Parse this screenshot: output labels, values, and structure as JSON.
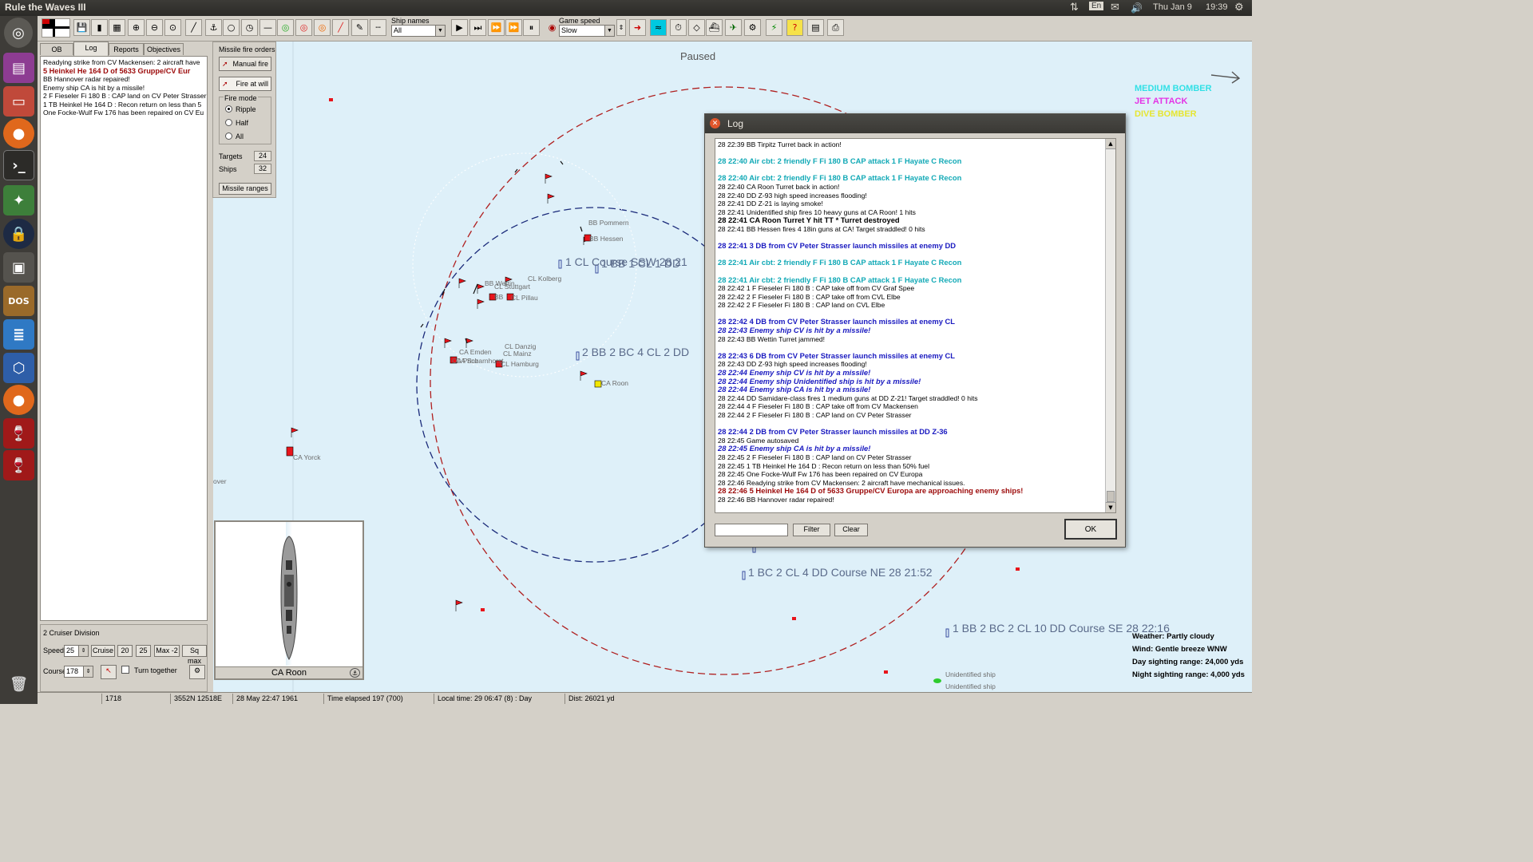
{
  "topbar": {
    "app_title": "Rule the Waves III",
    "lang": "En",
    "date": "Thu Jan 9",
    "time": "19:39"
  },
  "launcher": {
    "items": [
      "ubuntu-dash",
      "system-monitor",
      "file-manager",
      "firefox",
      "terminal",
      "color-app",
      "lock-app",
      "window-app",
      "dosbox",
      "text-editor",
      "virtualbox",
      "firefox-alt",
      "wine-app-1",
      "wine-app-2",
      "trash"
    ]
  },
  "toolbar": {
    "ship_names_label": "Ship names",
    "ship_names_value": "All",
    "game_speed_label": "Game speed",
    "game_speed_value": "Slow"
  },
  "left_panel": {
    "tabs": [
      "OB",
      "Log",
      "Reports",
      "Objectives"
    ],
    "active_tab": "Log",
    "log_lines": [
      {
        "text": "Readying strike from CV Mackensen: 2 aircraft have",
        "style": "normal"
      },
      {
        "text": "5 Heinkel He 164 D of 5633 Gruppe/CV Eur",
        "style": "red"
      },
      {
        "text": "BB Hannover radar repaired!",
        "style": "normal"
      },
      {
        "text": "Enemy ship CA is hit by a missile!",
        "style": "normal"
      },
      {
        "text": "2 F Fieseler Fi 180 B : CAP land on CV Peter Strasser",
        "style": "normal"
      },
      {
        "text": "1 TB Heinkel He 164 D : Recon return on less than 5",
        "style": "normal"
      },
      {
        "text": "One Focke-Wulf Fw 176 has been repaired on CV Eu",
        "style": "normal"
      }
    ],
    "division_title": "2 Cruiser Division",
    "speed_label": "Speed",
    "speed_value": "25",
    "speed_buttons": [
      "Cruise",
      "20",
      "25",
      "Max -2",
      "Sq max"
    ],
    "course_label": "Course",
    "course_value": "178",
    "turn_together_label": "Turn together"
  },
  "missile_panel": {
    "title": "Missile fire orders",
    "manual_fire": "Manual fire",
    "fire_at_will": "Fire at will",
    "fire_mode_label": "Fire mode",
    "modes": [
      "Ripple",
      "Half",
      "All"
    ],
    "selected_mode": "Ripple",
    "targets_label": "Targets",
    "targets_value": "24",
    "ships_label": "Ships",
    "ships_value": "32",
    "missile_ranges": "Missile ranges"
  },
  "map": {
    "paused_label": "Paused",
    "legend": [
      {
        "text": "MEDIUM BOMBER",
        "color": "#33e0e6"
      },
      {
        "text": "JET ATTACK",
        "color": "#e433e6"
      },
      {
        "text": "DIVE BOMBER",
        "color": "#e6e633"
      }
    ],
    "ship_labels": [
      "BB Pommern",
      "BB Hessen",
      "CL Kolberg",
      "BB Wettin",
      "CL Stuttgart",
      "BB",
      "CL Pillau",
      "CA Emden",
      "CA Prinz",
      "CA Scharnhorst",
      "CL Danzig",
      "CL Mainz",
      "CL Hamburg",
      "CA Roon",
      "CA Yorck",
      "Unidentified ship",
      "Unidentified ship"
    ],
    "group_labels": [
      "1 CL Course SSW 28 21",
      "1 BB 1 CL 1 DD",
      "2 BB 2 BC 4 CL 2 DD",
      "1 BC 2 CL 4 DD Course NE 28 21:52",
      "1 BB 2 BC 2 CL 10 DD Course SE 28 22:16"
    ],
    "partial_text": "over",
    "weather_lines": [
      "Weather: Partly cloudy",
      "Wind: Gentle breeze  WNW",
      "Day sighting range: 24,000 yds",
      "Night sighting range: 4,000 yds"
    ],
    "selected_ship_name": "CA Roon",
    "colors": {
      "sea": "#def0f9",
      "friendly_flag": "#e8141b",
      "selected_ship": "#f2e600",
      "red_circle": "#b02020",
      "blue_circle": "#1a2a7a"
    }
  },
  "statusbar": {
    "fields": [
      "1718",
      "3552N 12518E",
      "28 May 22:47 1961",
      "Time elapsed 197 (700)",
      "Local time: 29 06:47 (8) : Day",
      "Dist: 26021 yd"
    ]
  },
  "log_dialog": {
    "title": "Log",
    "filter_button": "Filter",
    "clear_button": "Clear",
    "ok_button": "OK",
    "entries": [
      {
        "t": "28 22:39  BB Tirpitz Turret back in action!",
        "s": "normal"
      },
      {
        "t": "",
        "s": "blank"
      },
      {
        "t": "28 22:40  Air cbt: 2  friendly F Fi 180 B CAP attack 1 F Hayate C Recon",
        "s": "teal"
      },
      {
        "t": "",
        "s": "blank"
      },
      {
        "t": "28 22:40  Air cbt: 2  friendly F Fi 180 B CAP attack 1 F Hayate C Recon",
        "s": "teal"
      },
      {
        "t": "28 22:40  CA Roon Turret back in action!",
        "s": "normal"
      },
      {
        "t": "28 22:40  DD Z-93 high speed increases flooding!",
        "s": "normal"
      },
      {
        "t": "28 22:41  DD Z-21 is laying smoke!",
        "s": "normal"
      },
      {
        "t": "28 22:41  Unidentified ship fires 10 heavy guns at CA Roon! 1 hits",
        "s": "normal"
      },
      {
        "t": "28 22:41   CA Roon Turret Y hit TT * Turret destroyed",
        "s": "bold"
      },
      {
        "t": "28 22:41  BB Hessen fires 4 18in guns at CA! Target straddled!  0 hits",
        "s": "normal"
      },
      {
        "t": "",
        "s": "blank"
      },
      {
        "t": "28 22:41   3 DB from CV Peter Strasser launch missiles at enemy DD",
        "s": "blue"
      },
      {
        "t": "",
        "s": "blank"
      },
      {
        "t": "28 22:41  Air cbt: 2  friendly F Fi 180 B CAP attack 1 F Hayate C Recon",
        "s": "teal"
      },
      {
        "t": "",
        "s": "blank"
      },
      {
        "t": "28 22:41  Air cbt: 2  friendly F Fi 180 B CAP attack 1 F Hayate C Recon",
        "s": "teal"
      },
      {
        "t": "28 22:42  1 F Fieseler Fi 180 B : CAP take off from CV Graf Spee",
        "s": "normal"
      },
      {
        "t": "28 22:42  2 F Fieseler Fi 180 B : CAP take off from CVL Elbe",
        "s": "normal"
      },
      {
        "t": "28 22:42  2 F Fieseler Fi 180 B : CAP land on CVL Elbe",
        "s": "normal"
      },
      {
        "t": "",
        "s": "blank"
      },
      {
        "t": "28 22:42   4 DB from CV Peter Strasser launch missiles at enemy CL",
        "s": "blue"
      },
      {
        "t": "28 22:43    Enemy ship CV is hit by a missile!",
        "s": "dblue"
      },
      {
        "t": "28 22:43  BB Wettin Turret jammed!",
        "s": "normal"
      },
      {
        "t": "",
        "s": "blank"
      },
      {
        "t": "28 22:43   6 DB from CV Peter Strasser launch missiles at enemy CL",
        "s": "blue"
      },
      {
        "t": "28 22:43  DD Z-93 high speed increases flooding!",
        "s": "normal"
      },
      {
        "t": "28 22:44    Enemy ship CV is hit by a missile!",
        "s": "dblue"
      },
      {
        "t": "28 22:44    Enemy ship Unidentified ship is hit by a missile!",
        "s": "dblue"
      },
      {
        "t": "28 22:44   Enemy ship CA is hit by a missile!",
        "s": "dblue"
      },
      {
        "t": "28 22:44  DD Samidare-class fires 1 medium guns at DD Z-21! Target straddled!  0 hits",
        "s": "normal"
      },
      {
        "t": "28 22:44  4 F Fieseler Fi 180 B : CAP take off from CV Mackensen",
        "s": "normal"
      },
      {
        "t": "28 22:44  2 F Fieseler Fi 180 B : CAP land on CV Peter Strasser",
        "s": "normal"
      },
      {
        "t": "",
        "s": "blank"
      },
      {
        "t": "28 22:44   2 DB from CV Peter Strasser launch missiles at DD Z-36",
        "s": "blue"
      },
      {
        "t": "28 22:45  Game autosaved",
        "s": "normal"
      },
      {
        "t": "28 22:45   Enemy ship CA is hit by a missile!",
        "s": "dblue"
      },
      {
        "t": "28 22:45  2 F Fieseler Fi 180 B : CAP land on CV Peter Strasser",
        "s": "normal"
      },
      {
        "t": "28 22:45  1 TB Heinkel He 164 D : Recon return on less than 50% fuel",
        "s": "normal"
      },
      {
        "t": "28 22:45  One Focke-Wulf Fw 176 has been repaired on CV Europa",
        "s": "normal"
      },
      {
        "t": "28 22:46  Readying strike from CV Mackensen: 2 aircraft have mechanical issues.",
        "s": "normal"
      },
      {
        "t": "28 22:46   5 Heinkel He 164 D of 5633 Gruppe/CV Europa are approaching enemy ships!",
        "s": "red"
      },
      {
        "t": "28 22:46  BB Hannover radar repaired!",
        "s": "normal"
      }
    ]
  }
}
